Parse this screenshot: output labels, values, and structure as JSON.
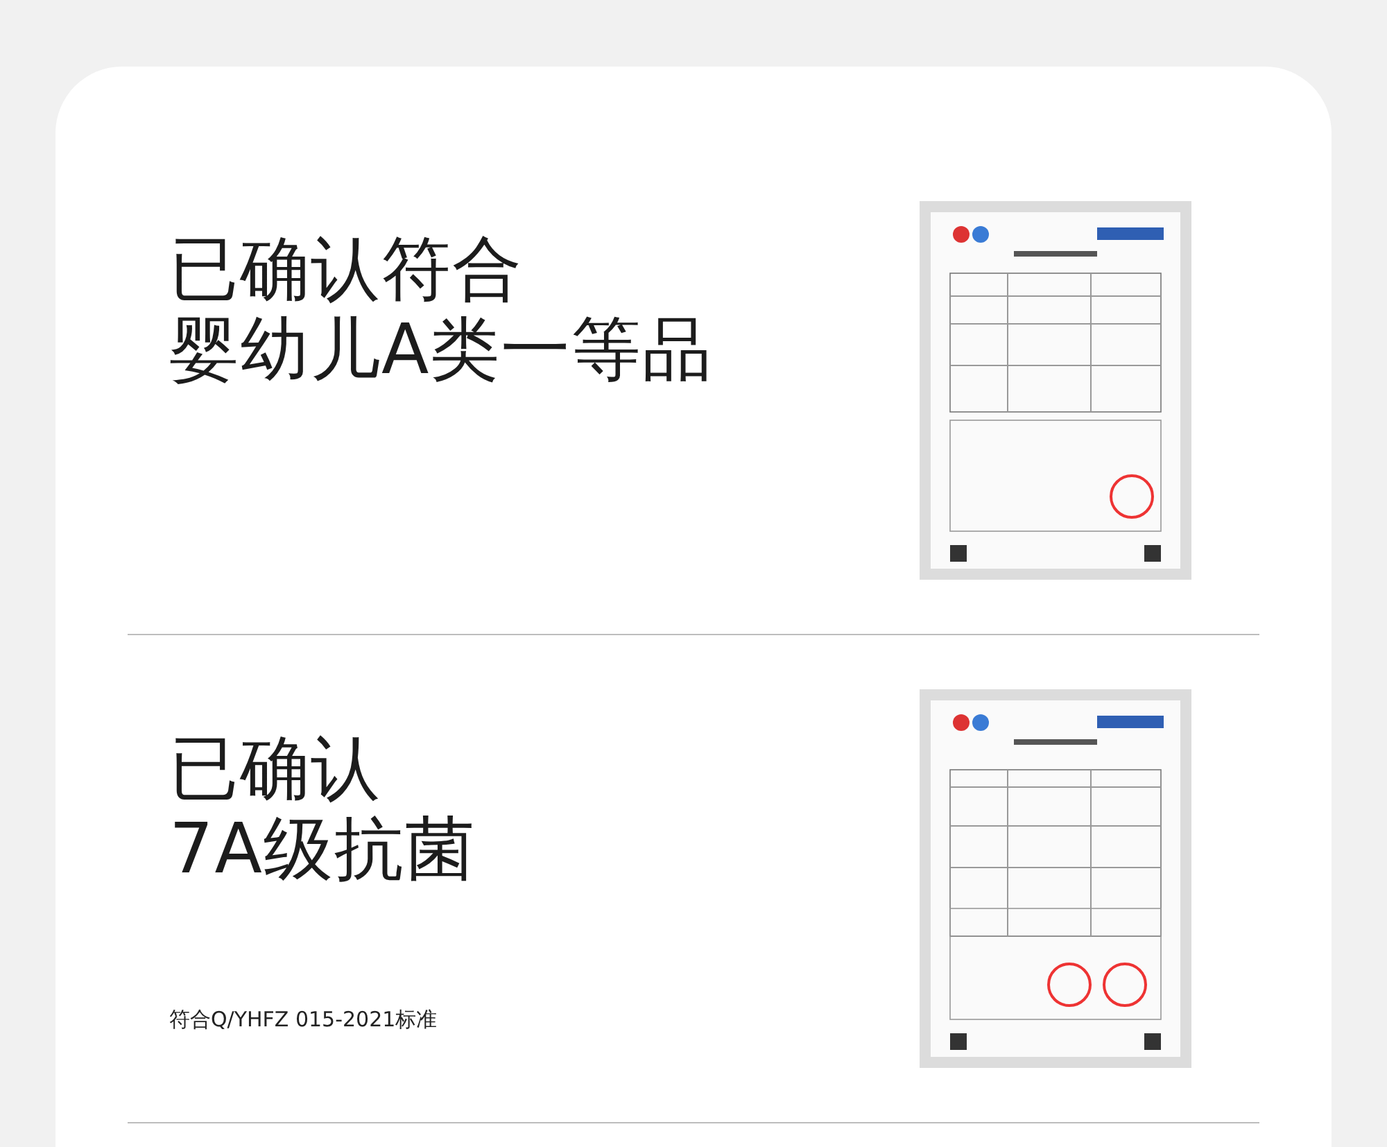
{
  "sections": [
    {
      "title_lines": [
        "已确认符合",
        "婴幼儿A类一等品"
      ]
    },
    {
      "title_lines": [
        "已确认",
        "7A级抗菌"
      ],
      "note": "符合Q/YHFZ 015-2021标准"
    }
  ]
}
